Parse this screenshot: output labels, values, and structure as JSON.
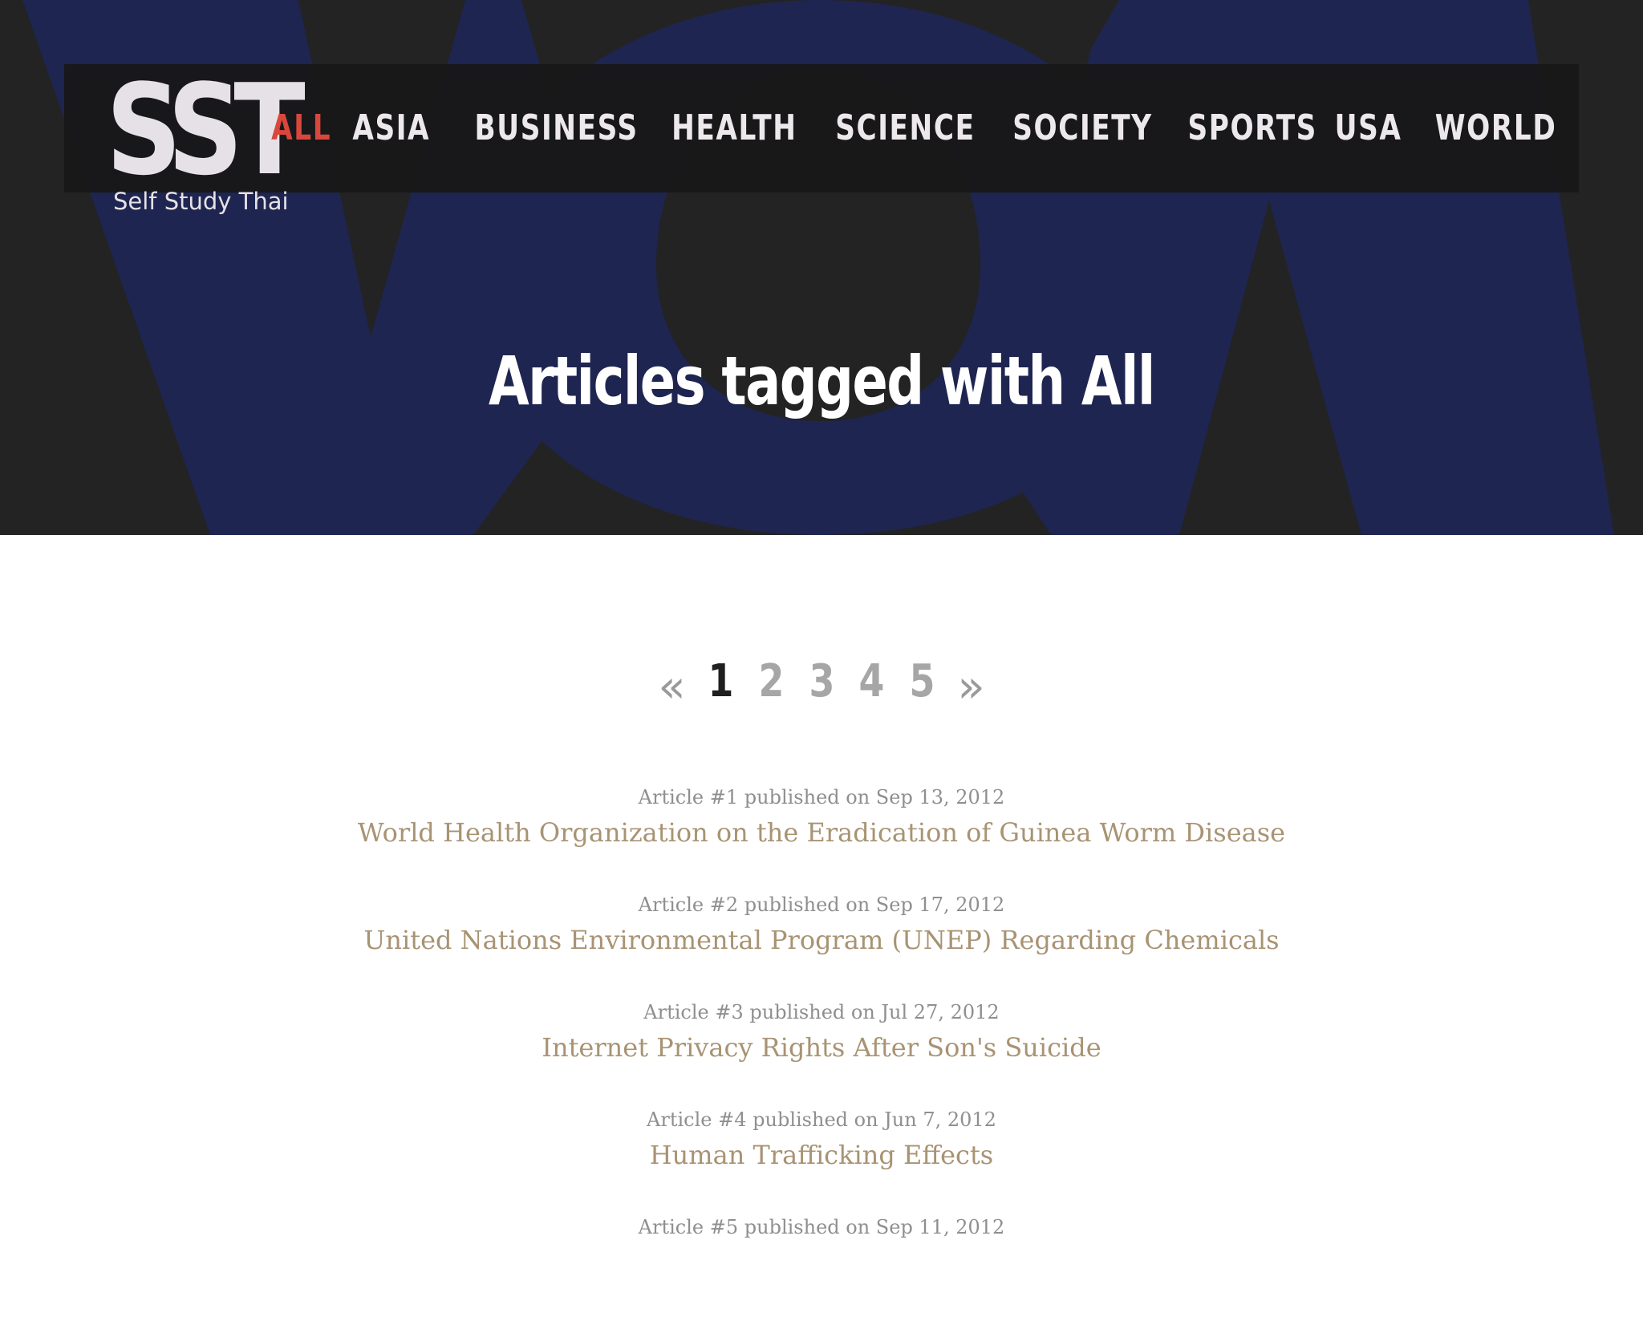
{
  "header": {
    "logo_text": "SST",
    "logo_subtitle": "Self Study Thai",
    "nav": [
      {
        "label": "ALL",
        "active": true
      },
      {
        "label": "ASIA",
        "active": false
      },
      {
        "label": "BUSINESS",
        "active": false
      },
      {
        "label": "HEALTH",
        "active": false
      },
      {
        "label": "SCIENCE",
        "active": false
      },
      {
        "label": "SOCIETY",
        "active": false
      },
      {
        "label": "SPORTS",
        "active": false
      },
      {
        "label": "USA",
        "active": false
      },
      {
        "label": "WORLD",
        "active": false
      }
    ]
  },
  "hero": {
    "title": "Articles tagged with All"
  },
  "pagination": {
    "prev": "«",
    "next": "»",
    "pages": [
      "1",
      "2",
      "3",
      "4",
      "5"
    ],
    "current": "1"
  },
  "articles": [
    {
      "meta": "Article #1 published on Sep 13, 2012",
      "title": "World Health Organization on the Eradication of Guinea Worm Disease"
    },
    {
      "meta": "Article #2 published on Sep 17, 2012",
      "title": "United Nations Environmental Program (UNEP) Regarding Chemicals"
    },
    {
      "meta": "Article #3 published on Jul 27, 2012",
      "title": "Internet Privacy Rights After Son's Suicide"
    },
    {
      "meta": "Article #4 published on Jun 7, 2012",
      "title": "Human Trafficking Effects"
    },
    {
      "meta": "Article #5 published on Sep 11, 2012",
      "title": ""
    }
  ],
  "colors": {
    "hero_background": "#232323",
    "hero_shape": "#1e2550",
    "nav_active": "#d9473c",
    "nav_text": "#ece8ec",
    "article_link": "#a89373",
    "meta_text": "#8f8f8f"
  }
}
